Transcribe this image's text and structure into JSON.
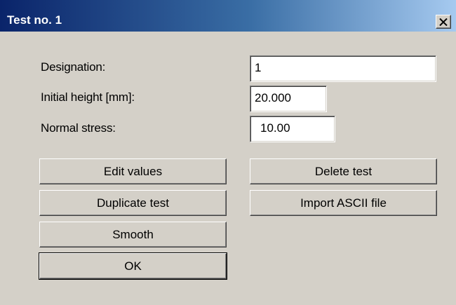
{
  "window": {
    "title": "Test no. 1",
    "close_icon": "close-icon"
  },
  "colors": {
    "titlebar_start": "#0a246a",
    "titlebar_end": "#a6caf0",
    "dialog_bg": "#d4d0c8"
  },
  "form": {
    "designation": {
      "label": "Designation:",
      "value": "1"
    },
    "initial_height": {
      "label": "Initial height [mm]:",
      "value": "20.000"
    },
    "normal_stress": {
      "label": "Normal stress:",
      "value": "10.00"
    }
  },
  "buttons": {
    "edit_values": "Edit values",
    "delete_test": "Delete test",
    "duplicate_test": "Duplicate test",
    "import_ascii": "Import ASCII file",
    "smooth": "Smooth",
    "ok": "OK"
  }
}
